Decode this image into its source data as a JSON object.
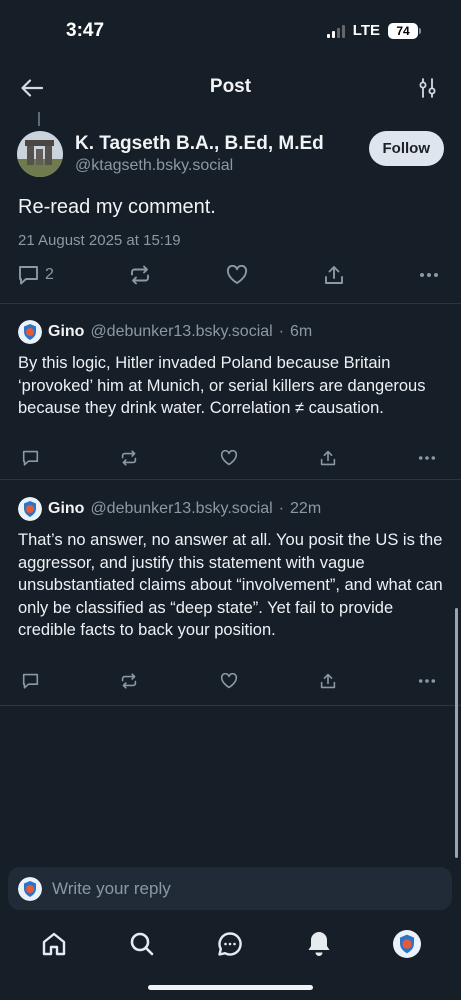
{
  "status_bar": {
    "time": "3:47",
    "network": "LTE",
    "battery": "74"
  },
  "header": {
    "title": "Post",
    "back_icon": "arrow-left-icon",
    "filter_icon": "sliders-icon"
  },
  "main_post": {
    "author_name": "K. Tagseth B.A., B.Ed, M.Ed",
    "handle": "@ktagseth.bsky.social",
    "follow_label": "Follow",
    "text": "Re-read my comment.",
    "date": "21 August 2025 at 15:19",
    "reply_count": "2"
  },
  "replies": [
    {
      "author_name": "Gino",
      "handle": "@debunker13.bsky.social",
      "age": "6m",
      "text": "By this logic, Hitler invaded Poland because Britain ‘provoked’ him at Munich, or serial killers are dangerous because they drink water. Correlation ≠ causation."
    },
    {
      "author_name": "Gino",
      "handle": "@debunker13.bsky.social",
      "age": "22m",
      "text": "That’s no answer, no answer at all.  You posit the US is the aggressor, and justify this statement with vague unsubstantiated claims about “involvement”, and what can only be classified as “deep state”. Yet fail to provide credible facts to back your position."
    }
  ],
  "compose": {
    "placeholder": "Write your reply"
  },
  "tabbar": {
    "items": [
      "home-icon",
      "search-icon",
      "chat-icon",
      "bell-icon",
      "profile-avatar"
    ]
  },
  "colors": {
    "background": "#161e27",
    "muted": "#8b98a5",
    "accent": "#1083fe"
  }
}
